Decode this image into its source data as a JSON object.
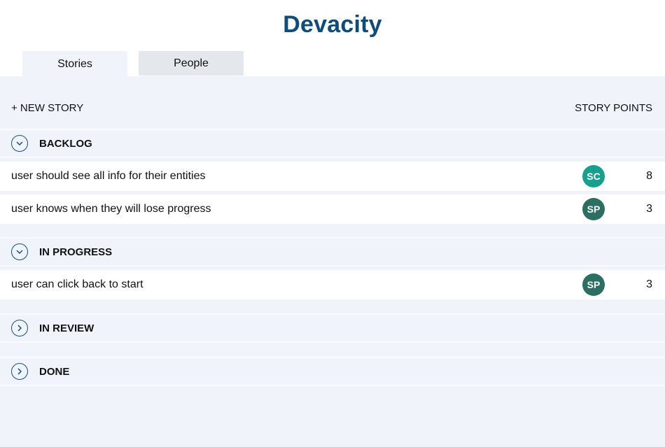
{
  "app": {
    "title": "Devacity"
  },
  "tabs": [
    {
      "label": "Stories",
      "active": true
    },
    {
      "label": "People",
      "active": false
    }
  ],
  "toolbar": {
    "new_story_label": "+ NEW STORY",
    "story_points_label": "STORY POINTS"
  },
  "colors": {
    "title": "#0f4c7a",
    "panel": "#f1f3fa",
    "avatar_sc": "#17a08d",
    "avatar_sp": "#2d6e63",
    "toggle": "#12507f"
  },
  "groups": [
    {
      "title": "BACKLOG",
      "expanded": true,
      "toggle_icon": "chevron-down-icon",
      "stories": [
        {
          "title": "user should see all info for their entities",
          "assignee": "SC",
          "points": "8"
        },
        {
          "title": "user knows when they will lose progress",
          "assignee": "SP",
          "points": "3"
        }
      ]
    },
    {
      "title": "IN PROGRESS",
      "expanded": true,
      "toggle_icon": "chevron-down-icon",
      "stories": [
        {
          "title": "user can click back to start",
          "assignee": "SP",
          "points": "3"
        }
      ]
    },
    {
      "title": "IN REVIEW",
      "expanded": false,
      "toggle_icon": "chevron-right-icon",
      "stories": []
    },
    {
      "title": "DONE",
      "expanded": false,
      "toggle_icon": "chevron-right-icon",
      "stories": []
    }
  ]
}
